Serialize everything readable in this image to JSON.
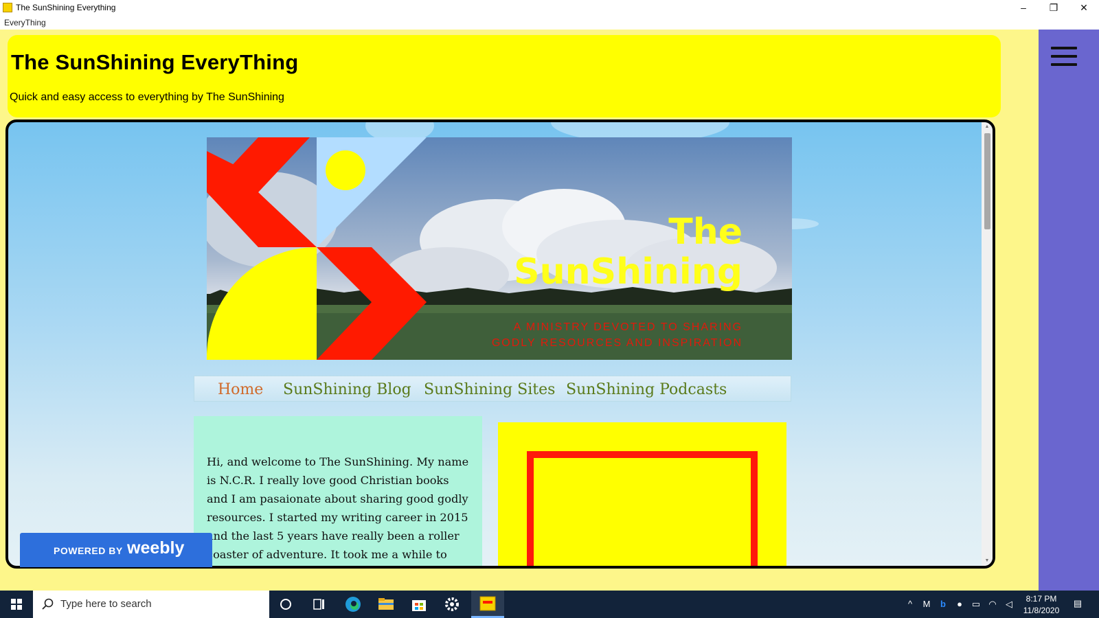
{
  "window": {
    "title": "The SunShining Everything",
    "subtitle": "EveryThing",
    "minimize_glyph": "–",
    "restore_glyph": "❐",
    "close_glyph": "✕"
  },
  "header": {
    "title": "The SunShining EveryThing",
    "subtitle": "Quick and easy access to everything by The SunShining",
    "background": "#ffff00"
  },
  "sidebar": {
    "background": "#6a66cf",
    "menu_icon": "hamburger-menu-icon"
  },
  "banner": {
    "line1": "The",
    "line2": "SunShining",
    "tagline1": "A Ministry Devoted to Sharing",
    "tagline2": "Godly Resources and Inspiration",
    "colors": {
      "red": "#ff1a00",
      "yellow": "#ffff00",
      "light_blue": "#b3ddff"
    }
  },
  "nav": {
    "items": [
      {
        "label": "Home",
        "active": true
      },
      {
        "label": "SunShining Blog",
        "active": false
      },
      {
        "label": "SunShining Sites",
        "active": false
      },
      {
        "label": "SunShining Podcasts",
        "active": false
      }
    ]
  },
  "welcome": {
    "text": "Hi, and welcome to The SunShining. My name is N.C.R. I really love good Christian books and I am pasaionate about sharing good godly resources. I started my writing career in 2015 and the last 5 years have really been a roller coaster of adventure. It took me a while to short my self"
  },
  "weebly": {
    "powered_by": "POWERED BY",
    "logo": "weebly"
  },
  "taskbar": {
    "search_placeholder": "Type here to search",
    "time": "8:17 PM",
    "date": "11/8/2020",
    "pinned": [
      "task-view-icon",
      "edge-browser-icon",
      "file-explorer-icon",
      "store-icon",
      "settings-icon",
      "sunshining-app-icon"
    ],
    "tray": [
      "chevron-up-icon",
      "gmail-icon",
      "bing-icon",
      "discord-icon",
      "battery-icon",
      "wifi-icon",
      "volume-icon",
      "notification-icon"
    ]
  }
}
